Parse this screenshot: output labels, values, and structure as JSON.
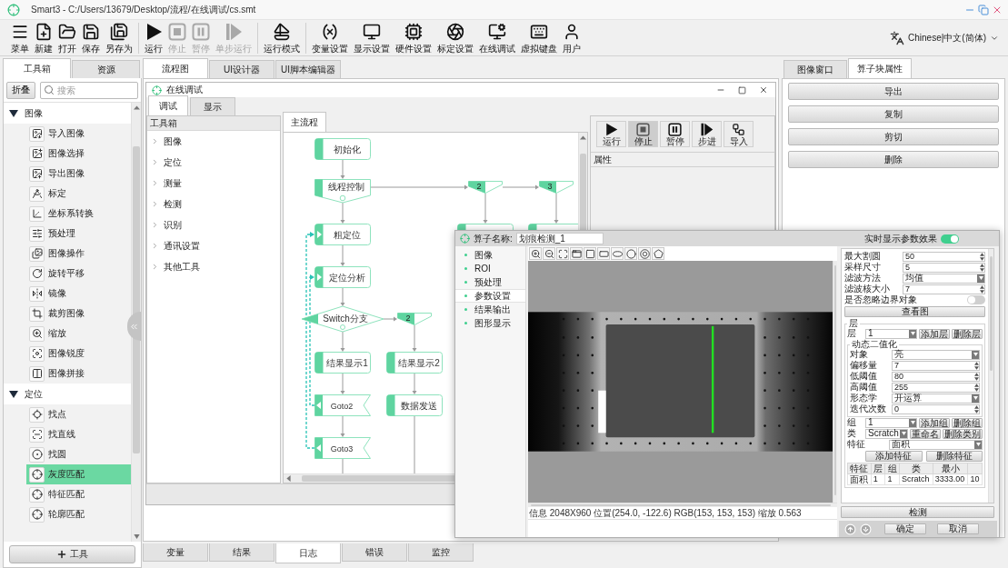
{
  "window": {
    "title": "Smart3 - C:/Users/13679/Desktop/流程/在线调试/cs.smt"
  },
  "toolbar": {
    "groups": [
      {
        "items": [
          {
            "label": "菜单",
            "disabled": false
          },
          {
            "label": "新建",
            "disabled": false
          },
          {
            "label": "打开",
            "disabled": false
          },
          {
            "label": "保存",
            "disabled": false
          },
          {
            "label": "另存为",
            "disabled": false
          }
        ]
      },
      {
        "items": [
          {
            "label": "运行",
            "disabled": false
          },
          {
            "label": "停止",
            "disabled": true
          },
          {
            "label": "暂停",
            "disabled": true
          },
          {
            "label": "单步运行",
            "disabled": true
          }
        ]
      },
      {
        "items": [
          {
            "label": "运行模式",
            "disabled": false
          }
        ]
      },
      {
        "items": [
          {
            "label": "变量设置",
            "disabled": false
          },
          {
            "label": "显示设置",
            "disabled": false
          },
          {
            "label": "硬件设置",
            "disabled": false
          },
          {
            "label": "标定设置",
            "disabled": false
          },
          {
            "label": "在线调试",
            "disabled": false
          },
          {
            "label": "虚拟键盘",
            "disabled": false
          },
          {
            "label": "用户",
            "disabled": false
          }
        ]
      }
    ],
    "language": "Chinese|中文(简体)"
  },
  "left_panel": {
    "tabs": [
      {
        "label": "工具箱",
        "selected": true
      },
      {
        "label": "资源",
        "selected": false
      }
    ],
    "collapse_button": "折叠",
    "search": {
      "placeholder": "搜索"
    },
    "tree": [
      {
        "label": "图像",
        "expanded": true,
        "children": [
          {
            "label": "导入图像",
            "selected": false
          },
          {
            "label": "图像选择",
            "selected": false
          },
          {
            "label": "导出图像",
            "selected": false
          },
          {
            "label": "标定",
            "selected": false
          },
          {
            "label": "坐标系转换",
            "selected": false
          },
          {
            "label": "预处理",
            "selected": false
          },
          {
            "label": "图像操作",
            "selected": false
          },
          {
            "label": "旋转平移",
            "selected": false
          },
          {
            "label": "镜像",
            "selected": false
          },
          {
            "label": "裁剪图像",
            "selected": false
          },
          {
            "label": "缩放",
            "selected": false
          },
          {
            "label": "图像锐度",
            "selected": false
          },
          {
            "label": "图像拼接",
            "selected": false
          }
        ]
      },
      {
        "label": "定位",
        "expanded": true,
        "children": [
          {
            "label": "找点",
            "selected": false
          },
          {
            "label": "找直线",
            "selected": false
          },
          {
            "label": "找圆",
            "selected": false
          },
          {
            "label": "灰度匹配",
            "selected": true
          },
          {
            "label": "特征匹配",
            "selected": false
          },
          {
            "label": "轮廓匹配",
            "selected": false
          }
        ]
      }
    ],
    "add_button": "工具"
  },
  "center_panel": {
    "tabs": [
      {
        "label": "流程图",
        "selected": true
      },
      {
        "label": "UI设计器",
        "selected": false
      },
      {
        "label": "UI脚本编辑器",
        "selected": false
      }
    ],
    "bottom_tabs": [
      {
        "label": "变量",
        "selected": false
      },
      {
        "label": "结果",
        "selected": false
      },
      {
        "label": "日志",
        "selected": true
      },
      {
        "label": "错误",
        "selected": false
      },
      {
        "label": "监控",
        "selected": false
      }
    ]
  },
  "debug_window": {
    "title": "在线调试",
    "tabs": [
      {
        "label": "调试",
        "selected": true
      },
      {
        "label": "显示",
        "selected": false
      }
    ],
    "toolbox": {
      "title": "工具箱",
      "items": [
        {
          "label": "图像",
          "expanded": false
        },
        {
          "label": "定位",
          "expanded": false
        },
        {
          "label": "测量",
          "expanded": false
        },
        {
          "label": "检测",
          "expanded": false
        },
        {
          "label": "识别",
          "expanded": false
        },
        {
          "label": "通讯设置",
          "expanded": false
        },
        {
          "label": "其他工具",
          "expanded": false
        }
      ]
    },
    "flow_tab": "主流程",
    "flow": {
      "nodes": [
        {
          "kind": "process",
          "label": "初始化"
        },
        {
          "kind": "thread",
          "label": "线程控制"
        },
        {
          "kind": "loop",
          "label": "粗定位"
        },
        {
          "kind": "loop",
          "label": "定位分析"
        },
        {
          "kind": "switch",
          "label": "Switch分支"
        },
        {
          "kind": "process",
          "label": "结果显示1"
        },
        {
          "kind": "process",
          "label": "结果显示2"
        },
        {
          "kind": "goto",
          "label": "Goto2"
        },
        {
          "kind": "process",
          "label": "数据发送"
        },
        {
          "kind": "goto",
          "label": "Goto3"
        },
        {
          "kind": "tag",
          "label": "2"
        },
        {
          "kind": "tag",
          "label": "3"
        },
        {
          "kind": "tag",
          "label": "2"
        },
        {
          "kind": "process"
        },
        {
          "kind": "process"
        }
      ]
    },
    "run_buttons": [
      {
        "label": "运行",
        "pressed": false
      },
      {
        "label": "停止",
        "pressed": true
      },
      {
        "label": "暂停",
        "pressed": false
      },
      {
        "label": "步进",
        "pressed": false
      },
      {
        "label": "导入",
        "pressed": false
      }
    ],
    "properties_title": "属性"
  },
  "right_panel": {
    "tabs": [
      {
        "label": "图像窗口",
        "selected": false
      },
      {
        "label": "算子块属性",
        "selected": true
      }
    ],
    "buttons": [
      "导出",
      "复制",
      "剪切",
      "删除"
    ]
  },
  "operator_dialog": {
    "name_label": "算子名称:",
    "name_value": "划痕检测_1",
    "live_preview": {
      "label": "实时显示参数效果",
      "on": true
    },
    "menu": [
      {
        "label": "图像",
        "selected": false
      },
      {
        "label": "ROI",
        "selected": false
      },
      {
        "label": "预处理",
        "selected": false
      },
      {
        "label": "参数设置",
        "selected": true
      },
      {
        "label": "结果输出",
        "selected": false
      },
      {
        "label": "图形显示",
        "selected": false
      }
    ],
    "status": "信息 2048X960 位置(254.0, -122.6) RGB(153, 153, 153) 缩放 0.563",
    "params": [
      {
        "kind": "spin",
        "label": "最大割圆",
        "value": "50"
      },
      {
        "kind": "spin",
        "label": "采样尺寸",
        "value": "5"
      },
      {
        "kind": "select",
        "label": "滤波方法",
        "value": "均值"
      },
      {
        "kind": "spin",
        "label": "滤波核大小",
        "value": "7"
      },
      {
        "kind": "toggle",
        "label": "是否忽略边界对象",
        "on": false
      },
      {
        "kind": "button",
        "label": "查看图"
      },
      {
        "kind": "fieldset",
        "title": "层",
        "items": [
          {
            "kind": "select_buttons",
            "label": "层",
            "value": "1",
            "buttons": [
              "添加层",
              "删除层"
            ]
          },
          {
            "kind": "fieldset",
            "title": "动态二值化",
            "items": [
              {
                "kind": "select",
                "label": "对象",
                "value": "亮"
              },
              {
                "kind": "spin",
                "label": "偏移量",
                "value": "7"
              },
              {
                "kind": "spin",
                "label": "低阈值",
                "value": "80"
              },
              {
                "kind": "spin",
                "label": "高阈值",
                "value": "255"
              },
              {
                "kind": "select",
                "label": "形态学",
                "value": "开运算"
              },
              {
                "kind": "spin",
                "label": "迭代次数",
                "value": "0"
              }
            ]
          },
          {
            "kind": "select_buttons",
            "label": "组",
            "value": "1",
            "buttons": [
              "添加组",
              "删除组"
            ]
          },
          {
            "kind": "select_buttons",
            "label": "类",
            "value": "Scratch",
            "buttons": [
              "重命名",
              "删除类别"
            ]
          },
          {
            "kind": "select",
            "label": "特征",
            "value": "面积"
          },
          {
            "kind": "buttons",
            "buttons": [
              "添加特征",
              "删除特征"
            ]
          },
          {
            "kind": "table",
            "columns": [
              "特征",
              "层",
              "组",
              "类",
              "最小"
            ],
            "rows": [
              [
                "面积",
                "1",
                "1",
                "Scratch",
                "3333.00",
                "10"
              ]
            ]
          }
        ]
      }
    ],
    "detect_button": "检测",
    "ok_button": "确定",
    "cancel_button": "取消"
  }
}
